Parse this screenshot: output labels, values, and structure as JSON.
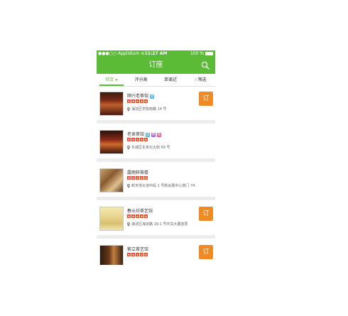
{
  "statusbar": {
    "carrier": "Applidium",
    "time": "11:27 AM",
    "battery_label": "100 %",
    "battery_level": 1.0
  },
  "navbar": {
    "title": "订座",
    "search_icon": "search-icon"
  },
  "filters": [
    {
      "label": "综合",
      "active": true
    },
    {
      "label": "评分高",
      "active": false
    },
    {
      "label": "距离近",
      "active": false
    },
    {
      "label": "筛选",
      "active": false
    }
  ],
  "colors": {
    "brand_green": "#5bba36",
    "star_red": "#f04a2c",
    "book_orange": "#f08a24",
    "badge_blue": "#3ab0e6",
    "badge_purple": "#a35cd6",
    "badge_pink": "#e84a8a"
  },
  "restaurants": [
    {
      "name": "顺兴老茶馆",
      "address": "海淀区学院南路 14 号",
      "stars": 5,
      "badges": [
        "blue"
      ],
      "bookable": true,
      "book_label": "订"
    },
    {
      "name": "老舍茶馆",
      "address": "东城区东单北大街 69 号",
      "stars": 5,
      "badges": [
        "blue",
        "purple",
        "pink"
      ],
      "bookable": false,
      "book_label": ""
    },
    {
      "name": "露雨轩茶楼",
      "address": "新天地大道中段 1 号新会展中心侧门 74",
      "stars": 5,
      "badges": [],
      "bookable": false,
      "book_label": ""
    },
    {
      "name": "春元坊茶艺馆",
      "address": "海淀区海淀路 19-1 号中关大厦首层",
      "stars": 5,
      "badges": [],
      "bookable": true,
      "book_label": "订"
    },
    {
      "name": "紫立茶艺馆",
      "address": "",
      "stars": 5,
      "badges": [],
      "bookable": true,
      "book_label": "订"
    }
  ]
}
